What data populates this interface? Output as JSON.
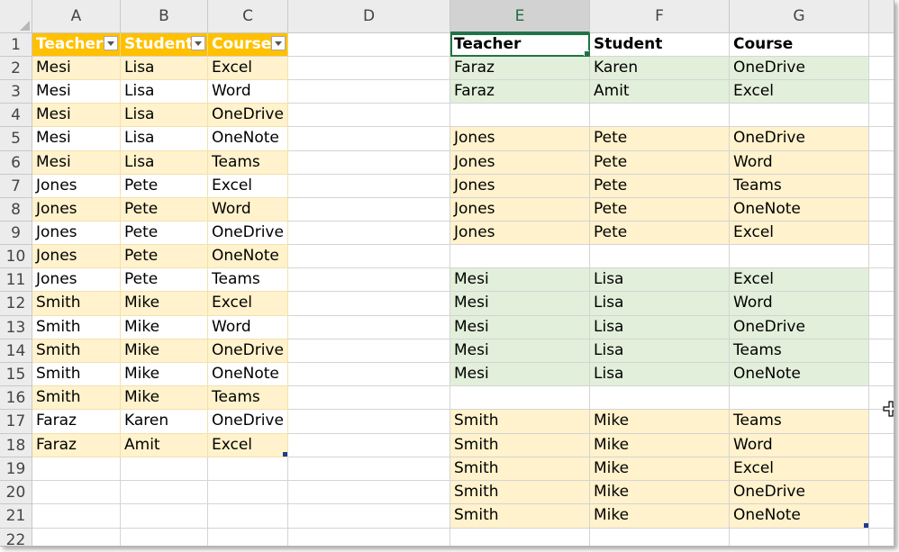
{
  "columns": [
    "A",
    "B",
    "C",
    "D",
    "E",
    "F",
    "G"
  ],
  "selected_column": "E",
  "rows": [
    "1",
    "2",
    "3",
    "4",
    "5",
    "6",
    "7",
    "8",
    "9",
    "10",
    "11",
    "12",
    "13",
    "14",
    "15",
    "16",
    "17",
    "18",
    "19",
    "20",
    "21",
    "22"
  ],
  "colors": {
    "table_header": "#ffc000",
    "band_yellow": "#fff2cc",
    "band_green": "#e2efda",
    "active_border": "#217346"
  },
  "left_table": {
    "headers": [
      "Teacher",
      "Student",
      "Course"
    ],
    "rows": [
      [
        "Mesi",
        "Lisa",
        "Excel"
      ],
      [
        "Mesi",
        "Lisa",
        "Word"
      ],
      [
        "Mesi",
        "Lisa",
        "OneDrive"
      ],
      [
        "Mesi",
        "Lisa",
        "OneNote"
      ],
      [
        "Mesi",
        "Lisa",
        "Teams"
      ],
      [
        "Jones",
        "Pete",
        "Excel"
      ],
      [
        "Jones",
        "Pete",
        "Word"
      ],
      [
        "Jones",
        "Pete",
        "OneDrive"
      ],
      [
        "Jones",
        "Pete",
        "OneNote"
      ],
      [
        "Jones",
        "Pete",
        "Teams"
      ],
      [
        "Smith",
        "Mike",
        "Excel"
      ],
      [
        "Smith",
        "Mike",
        "Word"
      ],
      [
        "Smith",
        "Mike",
        "OneDrive"
      ],
      [
        "Smith",
        "Mike",
        "OneNote"
      ],
      [
        "Smith",
        "Mike",
        "Teams"
      ],
      [
        "Faraz",
        "Karen",
        "OneDrive"
      ],
      [
        "Faraz",
        "Amit",
        "Excel"
      ]
    ]
  },
  "right_table": {
    "headers": [
      "Teacher",
      "Student",
      "Course"
    ],
    "rows": [
      {
        "cells": [
          "Faraz",
          "Karen",
          "OneDrive"
        ],
        "fill": "green"
      },
      {
        "cells": [
          "Faraz",
          "Amit",
          "Excel"
        ],
        "fill": "green"
      },
      {
        "cells": [
          "",
          "",
          ""
        ],
        "fill": "none"
      },
      {
        "cells": [
          "Jones",
          "Pete",
          "OneDrive"
        ],
        "fill": "yellow"
      },
      {
        "cells": [
          "Jones",
          "Pete",
          "Word"
        ],
        "fill": "yellow"
      },
      {
        "cells": [
          "Jones",
          "Pete",
          "Teams"
        ],
        "fill": "yellow"
      },
      {
        "cells": [
          "Jones",
          "Pete",
          "OneNote"
        ],
        "fill": "yellow"
      },
      {
        "cells": [
          "Jones",
          "Pete",
          "Excel"
        ],
        "fill": "yellow"
      },
      {
        "cells": [
          "",
          "",
          ""
        ],
        "fill": "none"
      },
      {
        "cells": [
          "Mesi",
          "Lisa",
          "Excel"
        ],
        "fill": "green"
      },
      {
        "cells": [
          "Mesi",
          "Lisa",
          "Word"
        ],
        "fill": "green"
      },
      {
        "cells": [
          "Mesi",
          "Lisa",
          "OneDrive"
        ],
        "fill": "green"
      },
      {
        "cells": [
          "Mesi",
          "Lisa",
          "Teams"
        ],
        "fill": "green"
      },
      {
        "cells": [
          "Mesi",
          "Lisa",
          "OneNote"
        ],
        "fill": "green"
      },
      {
        "cells": [
          "",
          "",
          ""
        ],
        "fill": "none"
      },
      {
        "cells": [
          "Smith",
          "Mike",
          "Teams"
        ],
        "fill": "yellow"
      },
      {
        "cells": [
          "Smith",
          "Mike",
          "Word"
        ],
        "fill": "yellow"
      },
      {
        "cells": [
          "Smith",
          "Mike",
          "Excel"
        ],
        "fill": "yellow"
      },
      {
        "cells": [
          "Smith",
          "Mike",
          "OneDrive"
        ],
        "fill": "yellow"
      },
      {
        "cells": [
          "Smith",
          "Mike",
          "OneNote"
        ],
        "fill": "yellow"
      }
    ]
  },
  "icons": {
    "select_all": "select-all-triangle-icon",
    "filter": "filter-dropdown-icon",
    "cursor": "move-cursor-icon"
  }
}
